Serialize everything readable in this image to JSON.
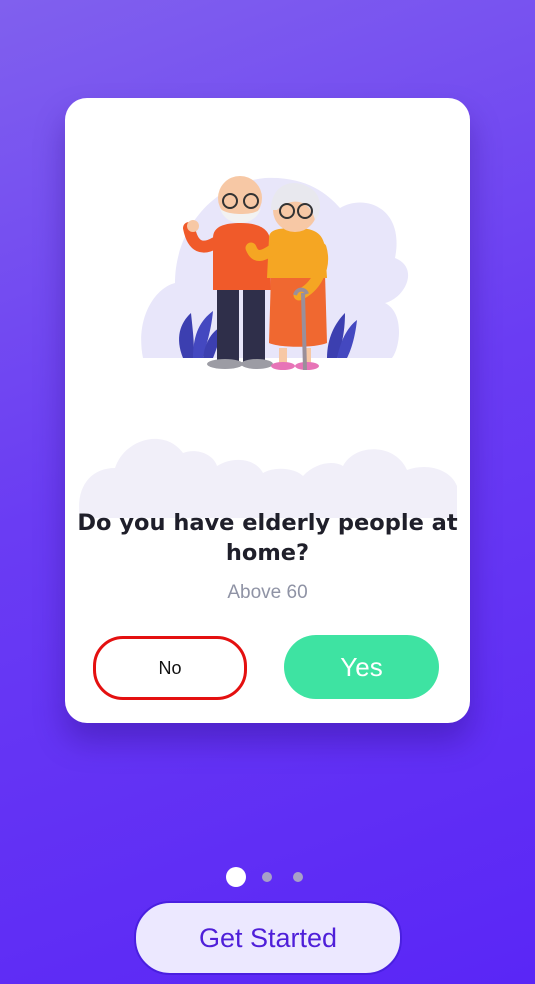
{
  "card": {
    "question": "Do you have elderly people at home?",
    "subtitle": "Above 60",
    "no_label": "No",
    "yes_label": "Yes",
    "illustration_icon": "elderly-couple-illustration"
  },
  "pagination": {
    "total": 3,
    "active": 1
  },
  "footer": {
    "get_started_label": "Get Started"
  },
  "colors": {
    "background_start": "#8060ee",
    "background_end": "#5a26f6",
    "yes_button": "#3ee3a2",
    "no_button_border": "#e41010",
    "get_started_text": "#4f1fd9"
  }
}
